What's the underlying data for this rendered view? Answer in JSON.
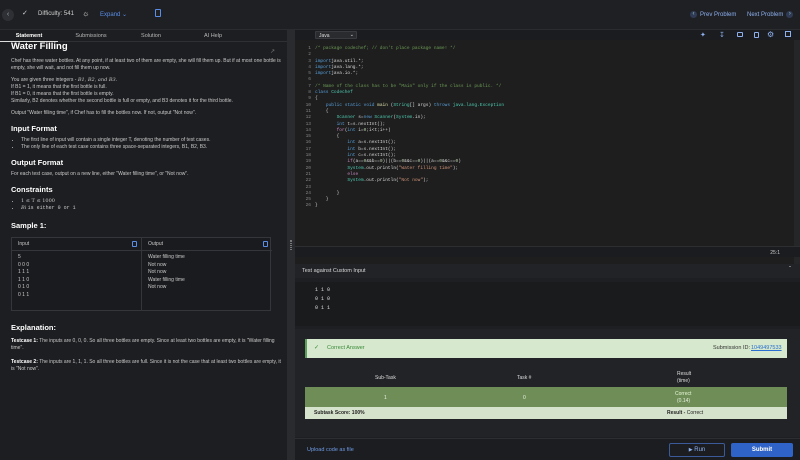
{
  "topbar": {
    "difficulty": "Difficulty: 541",
    "expand": "Expand",
    "prev": "Prev Problem",
    "next": "Next Problem"
  },
  "tabs": [
    "Statement",
    "Submissions",
    "Solution",
    "AI Help"
  ],
  "problem": {
    "title": "Water Filling",
    "intro": "Chef has three water bottles. At any point, if at least two of them are empty, she will fill them up. But if at most one bottle is empty, she will wait, and not fill them up now.",
    "given": "You are given three integers -",
    "given_vars": "B1, B2, and B3.",
    "if1": "If B1 = 1, it means that the first bottle is full.",
    "if0": "If B1 = 0, it means that the first bottle is empty.",
    "similarly": "Similarly, B2 denotes whether the second bottle is full or empty, and B3 denotes it for the third bottle.",
    "output_line": "Output \"Water filling time\", if Chef has to fill the bottles now. If not, output \"Not now\".",
    "input_format_h": "Input Format",
    "input_b1": "The first line of input will contain a single integer T, denoting the number of test cases.",
    "input_b2": "The only line of each test case contains three space-separated integers, B1, B2, B3.",
    "output_format_h": "Output Format",
    "output_format": "For each test case, output on a new line, either \"Water filling time\", or \"Not now\".",
    "constraints_h": "Constraints",
    "c1": "1 ≤ T ≤ 1000",
    "c2_pre": "Bi",
    "c2_post": "is either 0 or 1",
    "sample_h": "Sample 1:",
    "input_label": "Input",
    "output_label": "Output",
    "sample_input": [
      "5",
      "0 0 0",
      "1 1 1",
      "1 1 0",
      "0 1 0",
      "0 1 1"
    ],
    "sample_output": [
      "Water filling time",
      "Not now",
      "Not now",
      "Water filling time",
      "Not now"
    ],
    "explanation_h": "Explanation:",
    "tc1_label": "Testcase 1:",
    "tc1": "The inputs are 0, 0, 0. So all three bottles are empty. Since at least two bottles are empty, it is \"Water filling time\".",
    "tc2_label": "Testcase 2:",
    "tc2": "The inputs are 1, 1, 1. So all three bottles are full. Since it is not the case that at least two bottles are empty, it is \"Not now\"."
  },
  "editor": {
    "language": "Java",
    "cursor_pos": "25:1",
    "code_lines": [
      [
        [
          "cm",
          "/* package codechef; // don't place package name! */"
        ]
      ],
      [],
      [
        [
          "kw",
          "import"
        ],
        [
          "",
          "java.util.*;"
        ]
      ],
      [
        [
          "kw",
          "import"
        ],
        [
          "",
          "java.lang.*;"
        ]
      ],
      [
        [
          "kw",
          "import"
        ],
        [
          "",
          "java.io.*;"
        ]
      ],
      [],
      [
        [
          "cm",
          "/* Name of the class has to be \"Main\" only if the class is public. */"
        ]
      ],
      [
        [
          "kw",
          "class"
        ],
        [
          "ty",
          " Codechef"
        ]
      ],
      [
        [
          "",
          "{"
        ]
      ],
      [
        [
          "",
          "    "
        ],
        [
          "kw",
          "public static void"
        ],
        [
          "fn",
          " main"
        ],
        [
          "",
          " ("
        ],
        [
          "ty",
          "String"
        ],
        [
          "",
          "[] args) "
        ],
        [
          "kw",
          "throws"
        ],
        [
          "ty",
          " java.lang.Exception"
        ]
      ],
      [
        [
          "",
          "    {"
        ]
      ],
      [
        [
          "",
          "        "
        ],
        [
          "ty",
          "Scanner"
        ],
        [
          "",
          " s="
        ],
        [
          "kw",
          "new"
        ],
        [
          "ty",
          " Scanner"
        ],
        [
          "",
          "("
        ],
        [
          "ty",
          "System"
        ],
        [
          "",
          ".in);"
        ]
      ],
      [
        [
          "",
          "        "
        ],
        [
          "kw",
          "int"
        ],
        [
          "",
          " t=s.nextInt();"
        ]
      ],
      [
        [
          "",
          "        "
        ],
        [
          "pk",
          "for"
        ],
        [
          "",
          "("
        ],
        [
          "kw",
          "int"
        ],
        [
          "",
          " i="
        ],
        [
          "nu",
          "0"
        ],
        [
          "",
          ";i<t;i++)"
        ]
      ],
      [
        [
          "",
          "        {"
        ]
      ],
      [
        [
          "",
          "            "
        ],
        [
          "kw",
          "int"
        ],
        [
          "",
          " a=s.nextInt();"
        ]
      ],
      [
        [
          "",
          "            "
        ],
        [
          "kw",
          "int"
        ],
        [
          "",
          " b=s.nextInt();"
        ]
      ],
      [
        [
          "",
          "            "
        ],
        [
          "kw",
          "int"
        ],
        [
          "",
          " c=s.nextInt();"
        ]
      ],
      [
        [
          "",
          "            "
        ],
        [
          "pk",
          "if"
        ],
        [
          "",
          "(a=="
        ],
        [
          "nu",
          "0"
        ],
        [
          "",
          "&&b=="
        ],
        [
          "nu",
          "0"
        ],
        [
          "",
          ")||(b=="
        ],
        [
          "nu",
          "0"
        ],
        [
          "",
          "&&c=="
        ],
        [
          "nu",
          "0"
        ],
        [
          "",
          ")||(a=="
        ],
        [
          "nu",
          "0"
        ],
        [
          "",
          "&&c=="
        ],
        [
          "nu",
          "0"
        ],
        [
          "",
          ")"
        ]
      ],
      [
        [
          "",
          "            "
        ],
        [
          "ty",
          "System"
        ],
        [
          "",
          ".out.println("
        ],
        [
          "st",
          "\"Water filling time\""
        ],
        [
          "",
          ");"
        ]
      ],
      [
        [
          "",
          "            "
        ],
        [
          "pk",
          "else"
        ]
      ],
      [
        [
          "",
          "            "
        ],
        [
          "ty",
          "System"
        ],
        [
          "",
          ".out.println("
        ],
        [
          "st",
          "\"Not now\""
        ],
        [
          "",
          ");"
        ]
      ],
      [],
      [
        [
          "",
          "        }"
        ]
      ],
      [
        [
          "",
          "    }"
        ]
      ],
      [
        [
          "",
          "}"
        ]
      ]
    ]
  },
  "custom": {
    "label": "Test against Custom Input",
    "lines": [
      "1 1 0",
      "0 1 0",
      "0 1 1"
    ]
  },
  "result": {
    "status": "Correct Answer",
    "submission_label": "Submission ID:",
    "submission_id": "1049497533",
    "col_subtask": "Sub-Task",
    "col_task": "Task #",
    "col_result": "Result",
    "col_result2": "(time)",
    "row_subtask": "1",
    "row_task": "0",
    "row_result": "Correct",
    "row_time": "(0.14)",
    "score": "Subtask Score: 100%",
    "final_label": "Result -",
    "final_value": "Correct"
  },
  "bottom": {
    "upload": "Upload code as file",
    "run": "Run",
    "submit": "Submit"
  },
  "colors": {
    "accent": "#4a86e8",
    "success_bg": "#d6e8cd",
    "success_row": "#6f8e57"
  }
}
